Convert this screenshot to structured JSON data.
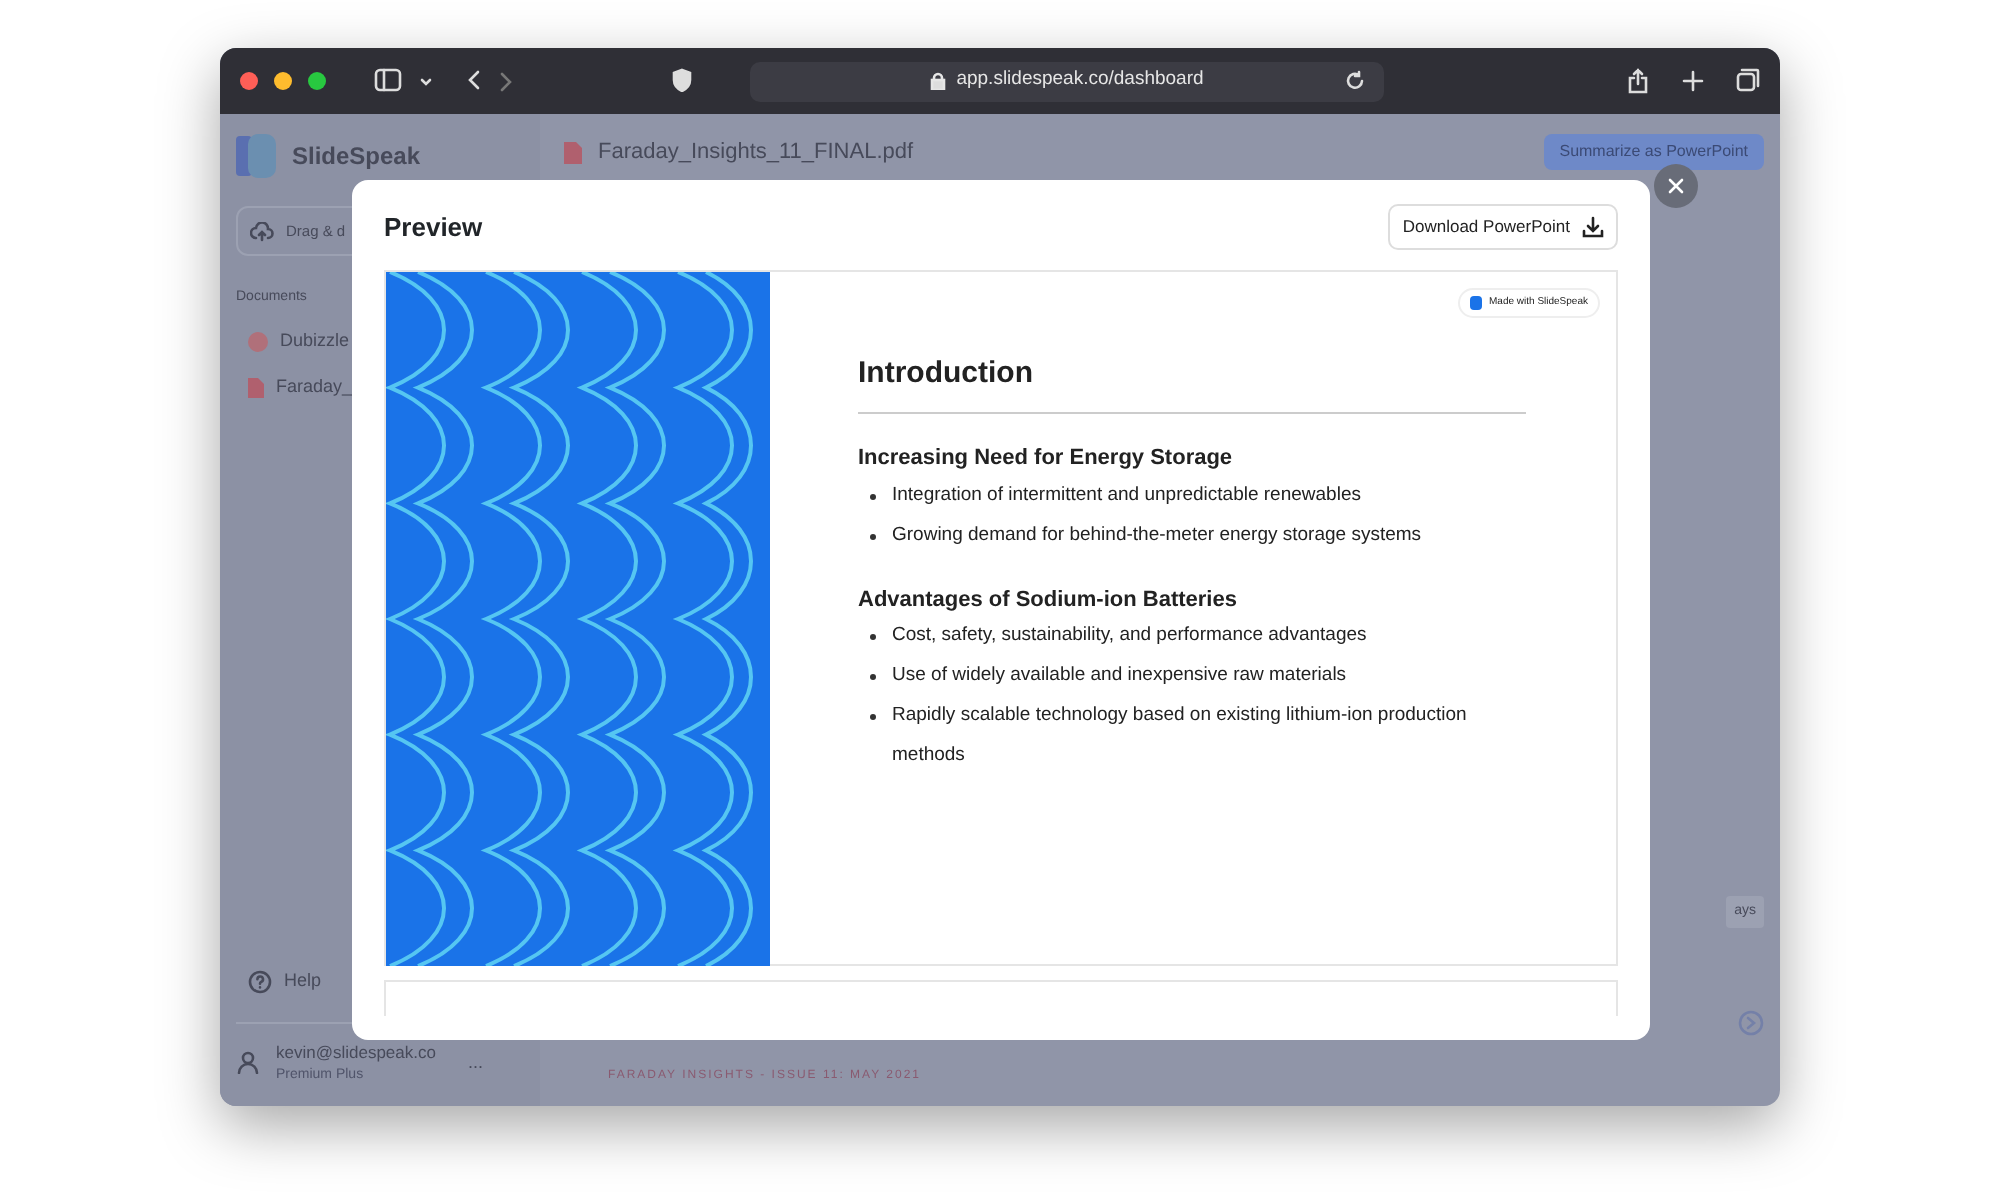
{
  "browser": {
    "url": "app.slidespeak.co/dashboard"
  },
  "app": {
    "logo_text": "SlideSpeak",
    "upload_text": "Drag & d",
    "documents_label": "Documents",
    "documents": [
      {
        "name": "Dubizzle",
        "kind": "presentation"
      },
      {
        "name": "Faraday_",
        "kind": "pdf"
      }
    ],
    "help": "Help",
    "user": {
      "email": "kevin@slidespeak.co",
      "plan": "Premium Plus"
    },
    "more": "...",
    "file_title": "Faraday_Insights_11_FINAL.pdf",
    "summarize_button": "Summarize as PowerPoint",
    "chip_text": "ays",
    "footer_text": "FARADAY INSIGHTS - ISSUE 11: MAY 2021"
  },
  "modal": {
    "title": "Preview",
    "download_button": "Download PowerPoint",
    "slide": {
      "badge": "Made with SlideSpeak",
      "title": "Introduction",
      "sections": [
        {
          "heading": "Increasing Need for Energy Storage",
          "bullets": [
            "Integration of intermittent and unpredictable renewables",
            "Growing demand for behind-the-meter energy storage systems"
          ]
        },
        {
          "heading": "Advantages of Sodium-ion Batteries",
          "bullets": [
            "Cost, safety, sustainability, and performance advantages",
            "Use of widely available and inexpensive raw materials",
            "Rapidly scalable technology based on existing lithium-ion production methods"
          ]
        }
      ]
    }
  }
}
